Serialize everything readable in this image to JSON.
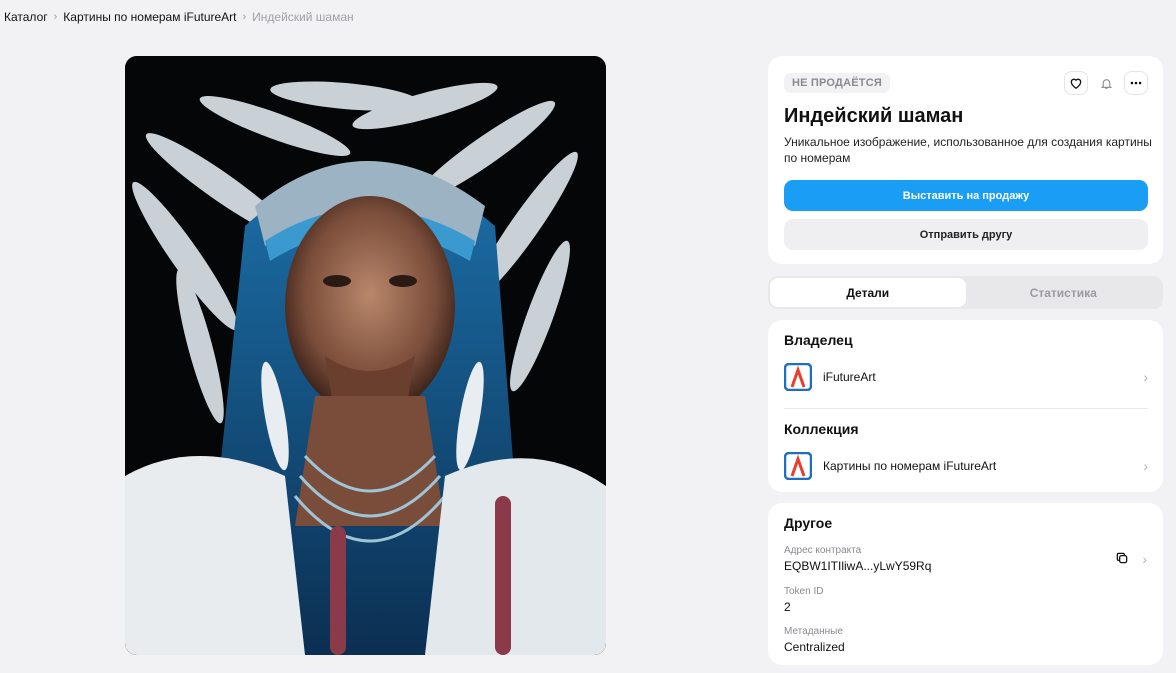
{
  "breadcrumb": {
    "items": [
      "Каталог",
      "Картины по номерам iFutureArt"
    ],
    "current": "Индейский шаман",
    "separator": "›"
  },
  "artwork": {
    "alt_icon": "nft-image"
  },
  "item": {
    "badge": "НЕ ПРОДАЁТСЯ",
    "title": "Индейский шаман",
    "description": "Уникальное изображение, использованное для создания картины по номерам",
    "sell_label": "Выставить на продажу",
    "send_label": "Отправить другу"
  },
  "tabs": [
    {
      "label": "Детали",
      "active": true
    },
    {
      "label": "Статистика",
      "active": false
    }
  ],
  "owner": {
    "heading": "Владелец",
    "name": "iFutureArt"
  },
  "collection": {
    "heading": "Коллекция",
    "name": "Картины по номерам iFutureArt"
  },
  "other": {
    "heading": "Другое",
    "contract_label": "Адрес контракта",
    "contract_value": "EQBW1ITIliwA...yLwY59Rq",
    "token_label": "Token ID",
    "token_value": "2",
    "metadata_label": "Метаданные",
    "metadata_value": "Centralized"
  },
  "colors": {
    "accent": "#1a9df5",
    "background": "#f2f2f4",
    "card": "#ffffff"
  }
}
